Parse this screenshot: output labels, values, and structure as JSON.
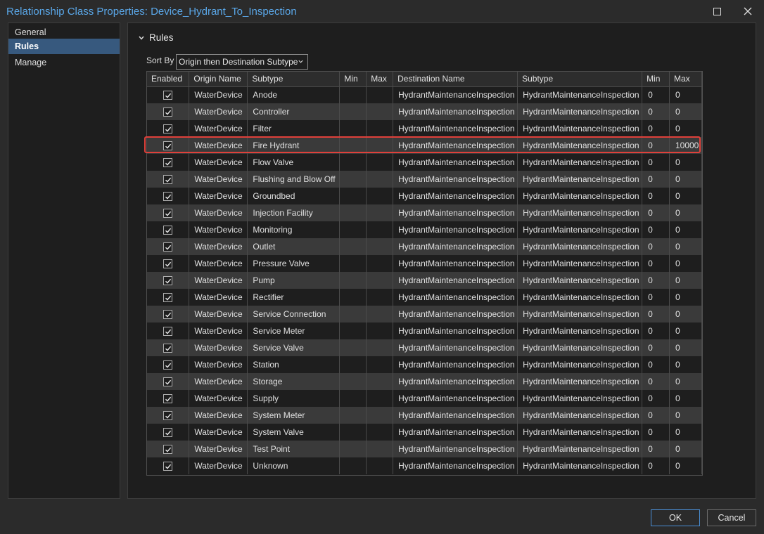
{
  "window": {
    "title": "Relationship Class Properties: Device_Hydrant_To_Inspection"
  },
  "nav": {
    "items": [
      {
        "label": "General",
        "active": false
      },
      {
        "label": "Rules",
        "active": true
      },
      {
        "label": "Manage",
        "active": false
      }
    ]
  },
  "section": {
    "title": "Rules"
  },
  "sort": {
    "label": "Sort By",
    "selected": "Origin then Destination Subtype"
  },
  "grid": {
    "columns": [
      "Enabled",
      "Origin Name",
      "Subtype",
      "Min",
      "Max",
      "Destination Name",
      "Subtype",
      "Min",
      "Max"
    ],
    "rows": [
      {
        "enabled": true,
        "origin": "WaterDevice",
        "subtype": "Anode",
        "min": "",
        "max": "",
        "dest": "HydrantMaintenanceInspection",
        "dest_subtype": "HydrantMaintenanceInspection",
        "dest_min": "0",
        "dest_max": "0"
      },
      {
        "enabled": true,
        "origin": "WaterDevice",
        "subtype": "Controller",
        "min": "",
        "max": "",
        "dest": "HydrantMaintenanceInspection",
        "dest_subtype": "HydrantMaintenanceInspection",
        "dest_min": "0",
        "dest_max": "0"
      },
      {
        "enabled": true,
        "origin": "WaterDevice",
        "subtype": "Filter",
        "min": "",
        "max": "",
        "dest": "HydrantMaintenanceInspection",
        "dest_subtype": "HydrantMaintenanceInspection",
        "dest_min": "0",
        "dest_max": "0"
      },
      {
        "enabled": true,
        "origin": "WaterDevice",
        "subtype": "Fire Hydrant",
        "min": "",
        "max": "",
        "dest": "HydrantMaintenanceInspection",
        "dest_subtype": "HydrantMaintenanceInspection",
        "dest_min": "0",
        "dest_max": "10000"
      },
      {
        "enabled": true,
        "origin": "WaterDevice",
        "subtype": "Flow Valve",
        "min": "",
        "max": "",
        "dest": "HydrantMaintenanceInspection",
        "dest_subtype": "HydrantMaintenanceInspection",
        "dest_min": "0",
        "dest_max": "0"
      },
      {
        "enabled": true,
        "origin": "WaterDevice",
        "subtype": "Flushing and Blow Off",
        "min": "",
        "max": "",
        "dest": "HydrantMaintenanceInspection",
        "dest_subtype": "HydrantMaintenanceInspection",
        "dest_min": "0",
        "dest_max": "0"
      },
      {
        "enabled": true,
        "origin": "WaterDevice",
        "subtype": "Groundbed",
        "min": "",
        "max": "",
        "dest": "HydrantMaintenanceInspection",
        "dest_subtype": "HydrantMaintenanceInspection",
        "dest_min": "0",
        "dest_max": "0"
      },
      {
        "enabled": true,
        "origin": "WaterDevice",
        "subtype": "Injection Facility",
        "min": "",
        "max": "",
        "dest": "HydrantMaintenanceInspection",
        "dest_subtype": "HydrantMaintenanceInspection",
        "dest_min": "0",
        "dest_max": "0"
      },
      {
        "enabled": true,
        "origin": "WaterDevice",
        "subtype": "Monitoring",
        "min": "",
        "max": "",
        "dest": "HydrantMaintenanceInspection",
        "dest_subtype": "HydrantMaintenanceInspection",
        "dest_min": "0",
        "dest_max": "0"
      },
      {
        "enabled": true,
        "origin": "WaterDevice",
        "subtype": "Outlet",
        "min": "",
        "max": "",
        "dest": "HydrantMaintenanceInspection",
        "dest_subtype": "HydrantMaintenanceInspection",
        "dest_min": "0",
        "dest_max": "0"
      },
      {
        "enabled": true,
        "origin": "WaterDevice",
        "subtype": "Pressure Valve",
        "min": "",
        "max": "",
        "dest": "HydrantMaintenanceInspection",
        "dest_subtype": "HydrantMaintenanceInspection",
        "dest_min": "0",
        "dest_max": "0"
      },
      {
        "enabled": true,
        "origin": "WaterDevice",
        "subtype": "Pump",
        "min": "",
        "max": "",
        "dest": "HydrantMaintenanceInspection",
        "dest_subtype": "HydrantMaintenanceInspection",
        "dest_min": "0",
        "dest_max": "0"
      },
      {
        "enabled": true,
        "origin": "WaterDevice",
        "subtype": "Rectifier",
        "min": "",
        "max": "",
        "dest": "HydrantMaintenanceInspection",
        "dest_subtype": "HydrantMaintenanceInspection",
        "dest_min": "0",
        "dest_max": "0"
      },
      {
        "enabled": true,
        "origin": "WaterDevice",
        "subtype": "Service Connection",
        "min": "",
        "max": "",
        "dest": "HydrantMaintenanceInspection",
        "dest_subtype": "HydrantMaintenanceInspection",
        "dest_min": "0",
        "dest_max": "0"
      },
      {
        "enabled": true,
        "origin": "WaterDevice",
        "subtype": "Service Meter",
        "min": "",
        "max": "",
        "dest": "HydrantMaintenanceInspection",
        "dest_subtype": "HydrantMaintenanceInspection",
        "dest_min": "0",
        "dest_max": "0"
      },
      {
        "enabled": true,
        "origin": "WaterDevice",
        "subtype": "Service Valve",
        "min": "",
        "max": "",
        "dest": "HydrantMaintenanceInspection",
        "dest_subtype": "HydrantMaintenanceInspection",
        "dest_min": "0",
        "dest_max": "0"
      },
      {
        "enabled": true,
        "origin": "WaterDevice",
        "subtype": "Station",
        "min": "",
        "max": "",
        "dest": "HydrantMaintenanceInspection",
        "dest_subtype": "HydrantMaintenanceInspection",
        "dest_min": "0",
        "dest_max": "0"
      },
      {
        "enabled": true,
        "origin": "WaterDevice",
        "subtype": "Storage",
        "min": "",
        "max": "",
        "dest": "HydrantMaintenanceInspection",
        "dest_subtype": "HydrantMaintenanceInspection",
        "dest_min": "0",
        "dest_max": "0"
      },
      {
        "enabled": true,
        "origin": "WaterDevice",
        "subtype": "Supply",
        "min": "",
        "max": "",
        "dest": "HydrantMaintenanceInspection",
        "dest_subtype": "HydrantMaintenanceInspection",
        "dest_min": "0",
        "dest_max": "0"
      },
      {
        "enabled": true,
        "origin": "WaterDevice",
        "subtype": "System Meter",
        "min": "",
        "max": "",
        "dest": "HydrantMaintenanceInspection",
        "dest_subtype": "HydrantMaintenanceInspection",
        "dest_min": "0",
        "dest_max": "0"
      },
      {
        "enabled": true,
        "origin": "WaterDevice",
        "subtype": "System Valve",
        "min": "",
        "max": "",
        "dest": "HydrantMaintenanceInspection",
        "dest_subtype": "HydrantMaintenanceInspection",
        "dest_min": "0",
        "dest_max": "0"
      },
      {
        "enabled": true,
        "origin": "WaterDevice",
        "subtype": "Test Point",
        "min": "",
        "max": "",
        "dest": "HydrantMaintenanceInspection",
        "dest_subtype": "HydrantMaintenanceInspection",
        "dest_min": "0",
        "dest_max": "0"
      },
      {
        "enabled": true,
        "origin": "WaterDevice",
        "subtype": "Unknown",
        "min": "",
        "max": "",
        "dest": "HydrantMaintenanceInspection",
        "dest_subtype": "HydrantMaintenanceInspection",
        "dest_min": "0",
        "dest_max": "0"
      }
    ]
  },
  "buttons": {
    "ok": "OK",
    "cancel": "Cancel"
  },
  "colors": {
    "title": "#5aa7e8",
    "nav_active": "#37597e",
    "highlight": "#e0403a",
    "row_alt": "#3a3a3a"
  }
}
